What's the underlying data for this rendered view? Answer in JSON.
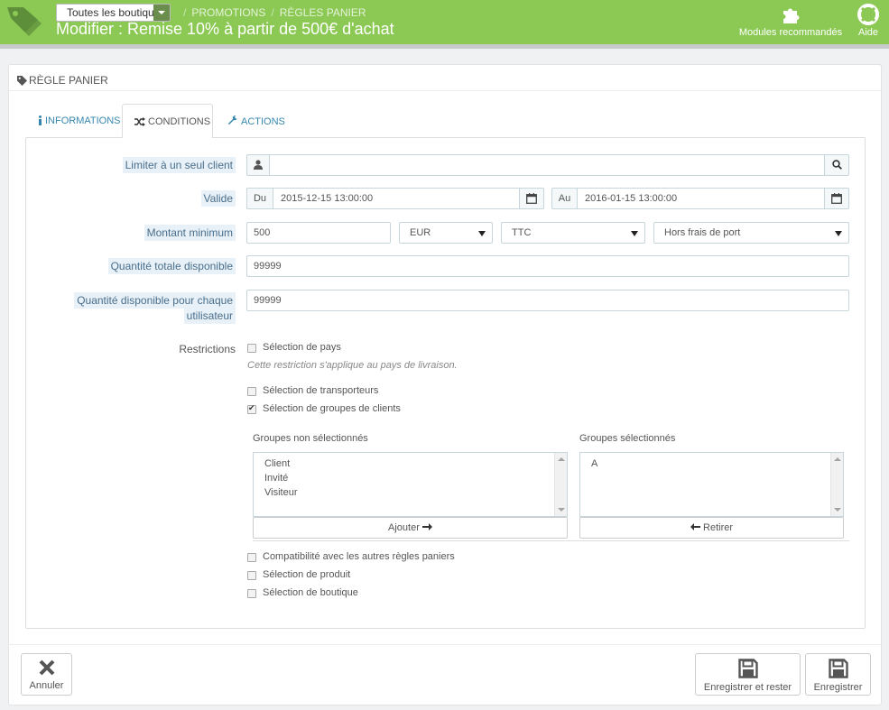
{
  "header": {
    "shop_select": "Toutes les boutiques",
    "breadcrumb": [
      "PROMOTIONS",
      "RÈGLES PANIER"
    ],
    "title": "Modifier : Remise 10% à partir de 500€ d'achat",
    "modules_label": "Modules recommandés",
    "help_label": "Aide",
    "colors": {
      "bar": "#8bc954",
      "accent": "#3586ae"
    }
  },
  "panel": {
    "heading": "RÈGLE PANIER",
    "tabs": [
      {
        "label": "INFORMATIONS",
        "icon": "info-icon"
      },
      {
        "label": "CONDITIONS",
        "icon": "shuffle-icon"
      },
      {
        "label": "ACTIONS",
        "icon": "wrench-icon"
      }
    ]
  },
  "form": {
    "client_label": "Limiter à un seul client",
    "client_value": "",
    "valid_label": "Valide",
    "from_prefix": "Du",
    "from_value": "2015-12-15 13:00:00",
    "to_prefix": "Au",
    "to_value": "2016-01-15 13:00:00",
    "min_amount_label": "Montant minimum",
    "min_amount_value": "500",
    "currency": "EUR",
    "tax": "TTC",
    "shipping": "Hors frais de port",
    "total_qty_label": "Quantité totale disponible",
    "total_qty_value": "99999",
    "user_qty_label_1": "Quantité disponible pour chaque",
    "user_qty_label_2": "utilisateur",
    "user_qty_value": "99999",
    "restrictions_label": "Restrictions",
    "country_label": "Sélection de pays",
    "country_help": "Cette restriction s'applique au pays de livraison.",
    "carrier_label": "Sélection de transporteurs",
    "group_label": "Sélection de groupes de clients",
    "unselected_title": "Groupes non sélectionnés",
    "unselected_items": [
      "Client",
      "Invité",
      "Visiteur"
    ],
    "selected_title": "Groupes sélectionnés",
    "selected_items": [
      "A"
    ],
    "add_button": "Ajouter",
    "remove_button": "Retirer",
    "compat_label": "Compatibilité avec les autres règles paniers",
    "product_label": "Sélection de produit",
    "shop_label": "Sélection de boutique"
  },
  "footer": {
    "cancel": "Annuler",
    "save_stay": "Enregistrer et rester",
    "save": "Enregistrer"
  }
}
